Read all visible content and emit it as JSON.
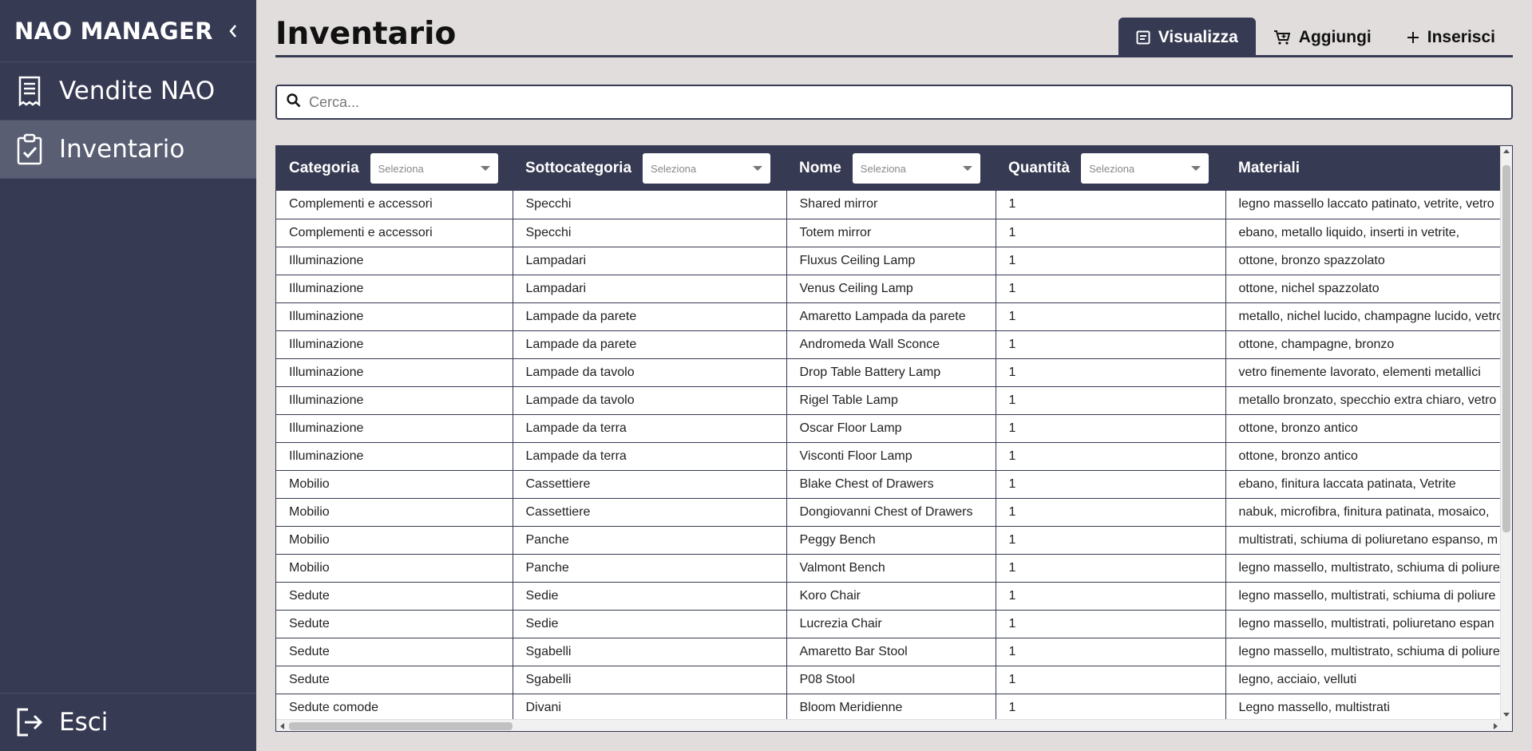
{
  "app": {
    "title": "NAO MANAGER"
  },
  "sidebar": {
    "items": [
      {
        "label": "Vendite NAO",
        "icon": "receipt-icon"
      },
      {
        "label": "Inventario",
        "icon": "clipboard-check-icon",
        "active": true
      }
    ],
    "logout_label": "Esci"
  },
  "page": {
    "title": "Inventario"
  },
  "tabs": [
    {
      "label": "Visualizza",
      "icon": "list-icon",
      "active": true
    },
    {
      "label": "Aggiungi",
      "icon": "cart-icon"
    },
    {
      "label": "Inserisci",
      "icon": "plus-icon"
    }
  ],
  "search": {
    "placeholder": "Cerca..."
  },
  "table": {
    "columns": [
      {
        "label": "Categoria",
        "filter": "Seleziona"
      },
      {
        "label": "Sottocategoria",
        "filter": "Seleziona"
      },
      {
        "label": "Nome",
        "filter": "Seleziona"
      },
      {
        "label": "Quantità",
        "filter": "Seleziona"
      },
      {
        "label": "Materiali"
      }
    ],
    "rows": [
      [
        "Complementi e accessori",
        "Specchi",
        "Shared mirror",
        "1",
        "legno massello laccato patinato, vetrite, vetro"
      ],
      [
        "Complementi e accessori",
        "Specchi",
        "Totem mirror",
        "1",
        "ebano, metallo liquido, inserti in vetrite,"
      ],
      [
        "Illuminazione",
        "Lampadari",
        "Fluxus Ceiling Lamp",
        "1",
        "ottone, bronzo spazzolato"
      ],
      [
        "Illuminazione",
        "Lampadari",
        "Venus Ceiling Lamp",
        "1",
        "ottone, nichel spazzolato"
      ],
      [
        "Illuminazione",
        "Lampade da parete",
        "Amaretto Lampada da parete",
        "1",
        "metallo, nichel lucido, champagne lucido, vetro"
      ],
      [
        "Illuminazione",
        "Lampade da parete",
        "Andromeda Wall Sconce",
        "1",
        "ottone, champagne, bronzo"
      ],
      [
        "Illuminazione",
        "Lampade da tavolo",
        "Drop Table Battery Lamp",
        "1",
        "vetro finemente lavorato, elementi metallici"
      ],
      [
        "Illuminazione",
        "Lampade da tavolo",
        "Rigel Table Lamp",
        "1",
        "metallo bronzato, specchio extra chiaro, vetro"
      ],
      [
        "Illuminazione",
        "Lampade da terra",
        "Oscar Floor Lamp",
        "1",
        "ottone, bronzo antico"
      ],
      [
        "Illuminazione",
        "Lampade da terra",
        "Visconti Floor Lamp",
        "1",
        "ottone, bronzo antico"
      ],
      [
        "Mobilio",
        "Cassettiere",
        "Blake Chest of Drawers",
        "1",
        "ebano, finitura laccata patinata, Vetrite"
      ],
      [
        "Mobilio",
        "Cassettiere",
        "Dongiovanni Chest of Drawers",
        "1",
        "nabuk, microfibra, finitura patinata, mosaico,"
      ],
      [
        "Mobilio",
        "Panche",
        "Peggy Bench",
        "1",
        "multistrati, schiuma di poliuretano espanso, m"
      ],
      [
        "Mobilio",
        "Panche",
        "Valmont Bench",
        "1",
        "legno massello, multistrato, schiuma di poliure"
      ],
      [
        "Sedute",
        "Sedie",
        "Koro Chair",
        "1",
        "legno massello, multistrati, schiuma di poliure"
      ],
      [
        "Sedute",
        "Sedie",
        "Lucrezia Chair",
        "1",
        "legno massello, multistrati, poliuretano espan"
      ],
      [
        "Sedute",
        "Sgabelli",
        "Amaretto Bar Stool",
        "1",
        "legno massello, multistrato, schiuma di poliure"
      ],
      [
        "Sedute",
        "Sgabelli",
        "P08 Stool",
        "1",
        "legno, acciaio, velluti"
      ],
      [
        "Sedute comode",
        "Divani",
        "Bloom Meridienne",
        "1",
        "Legno massello, multistrati"
      ]
    ]
  },
  "colors": {
    "primary": "#363a52",
    "sidebar_active": "#5a5e73",
    "background": "#e2dddd"
  }
}
